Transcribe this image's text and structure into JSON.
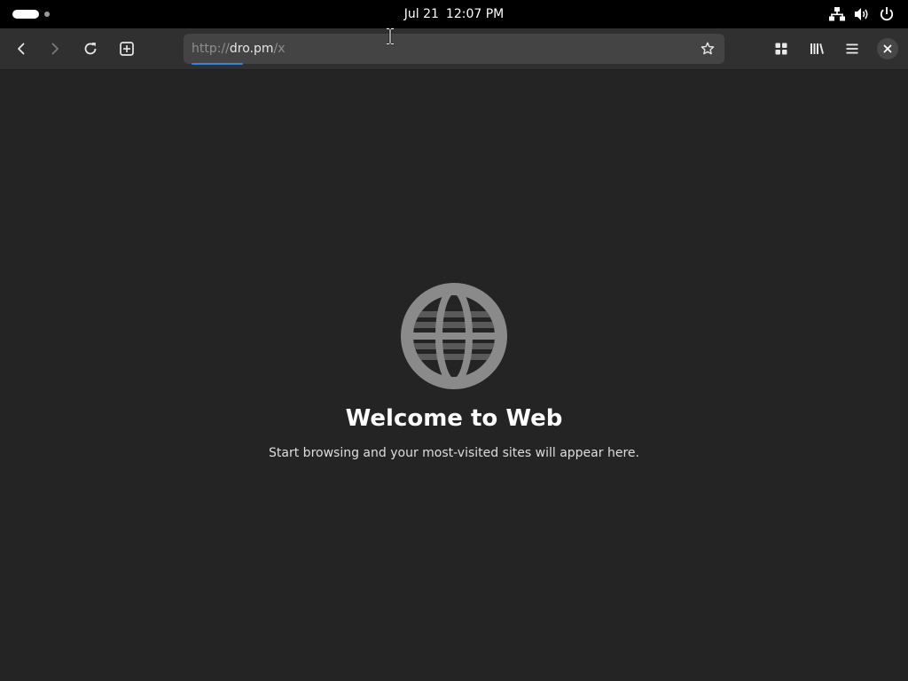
{
  "topbar": {
    "date": "Jul 21",
    "time": "12:07 PM",
    "icons": [
      "activities-indicator",
      "network-wired-icon",
      "volume-icon",
      "power-icon"
    ]
  },
  "browser": {
    "nav_icons": [
      "back-icon",
      "forward-icon",
      "reload-icon",
      "new-tab-icon"
    ],
    "url": {
      "scheme": "http://",
      "host": "dro.pm",
      "path": "/x"
    },
    "right_icons": [
      "tab-overview-icon",
      "library-icon",
      "hamburger-menu-icon",
      "close-icon"
    ],
    "accent_color": "#3584e4"
  },
  "page": {
    "icon": "globe-icon",
    "title": "Welcome to Web",
    "subtitle": "Start browsing and your most-visited sites will appear here."
  }
}
